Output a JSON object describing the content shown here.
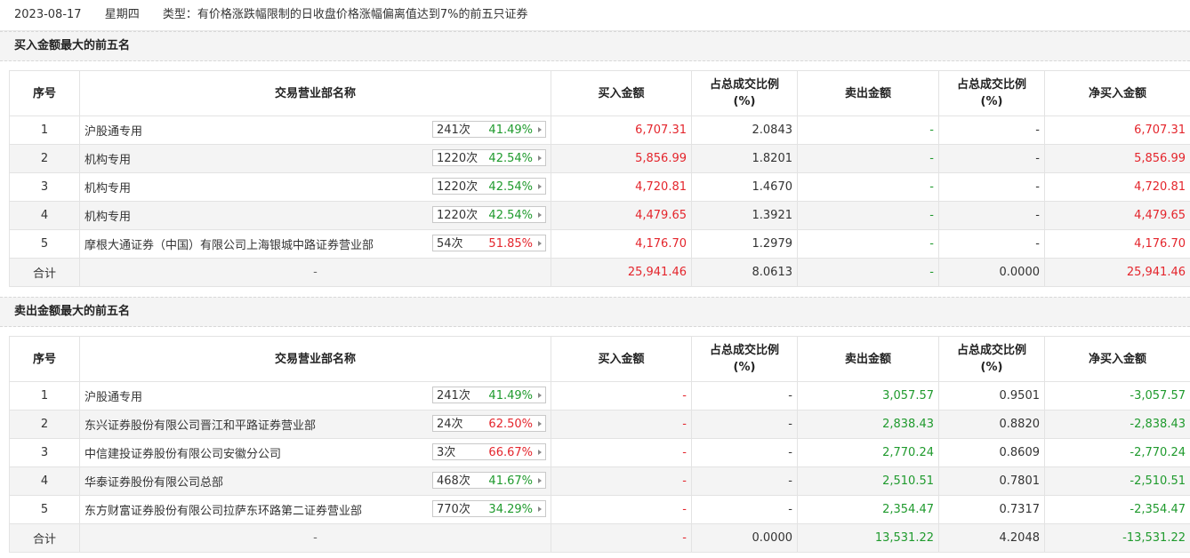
{
  "header": {
    "date": "2023-08-17",
    "weekday": "星期四",
    "type_text": "类型：有价格涨跌幅限制的日收盘价格涨幅偏离值达到7%的前五只证券"
  },
  "columns": {
    "seq": "序号",
    "dept": "交易营业部名称",
    "buy": "买入金额",
    "ratio1_line1": "占总成交比例",
    "ratio1_line2": "(%)",
    "sell": "卖出金额",
    "ratio2_line1": "占总成交比例",
    "ratio2_line2": "(%)",
    "net": "净买入金额"
  },
  "buy_section": {
    "title": "买入金额最大的前五名",
    "rows": [
      {
        "seq": "1",
        "name": "沪股通专用",
        "count": "241次",
        "pct": "41.49%",
        "pct_color": "green",
        "buy": "6,707.31",
        "buy_ratio": "2.0843",
        "sell": "-",
        "sell_ratio": "-",
        "net": "6,707.31"
      },
      {
        "seq": "2",
        "name": "机构专用",
        "count": "1220次",
        "pct": "42.54%",
        "pct_color": "green",
        "buy": "5,856.99",
        "buy_ratio": "1.8201",
        "sell": "-",
        "sell_ratio": "-",
        "net": "5,856.99"
      },
      {
        "seq": "3",
        "name": "机构专用",
        "count": "1220次",
        "pct": "42.54%",
        "pct_color": "green",
        "buy": "4,720.81",
        "buy_ratio": "1.4670",
        "sell": "-",
        "sell_ratio": "-",
        "net": "4,720.81"
      },
      {
        "seq": "4",
        "name": "机构专用",
        "count": "1220次",
        "pct": "42.54%",
        "pct_color": "green",
        "buy": "4,479.65",
        "buy_ratio": "1.3921",
        "sell": "-",
        "sell_ratio": "-",
        "net": "4,479.65"
      },
      {
        "seq": "5",
        "name": "摩根大通证券（中国）有限公司上海银城中路证券营业部",
        "count": "54次",
        "pct": "51.85%",
        "pct_color": "red",
        "buy": "4,176.70",
        "buy_ratio": "1.2979",
        "sell": "-",
        "sell_ratio": "-",
        "net": "4,176.70"
      }
    ],
    "total": {
      "label": "合计",
      "name": "-",
      "buy": "25,941.46",
      "buy_ratio": "8.0613",
      "sell": "-",
      "sell_ratio": "0.0000",
      "net": "25,941.46"
    }
  },
  "sell_section": {
    "title": "卖出金额最大的前五名",
    "rows": [
      {
        "seq": "1",
        "name": "沪股通专用",
        "count": "241次",
        "pct": "41.49%",
        "pct_color": "green",
        "buy": "-",
        "buy_ratio": "-",
        "sell": "3,057.57",
        "sell_ratio": "0.9501",
        "net": "-3,057.57"
      },
      {
        "seq": "2",
        "name": "东兴证券股份有限公司晋江和平路证券营业部",
        "count": "24次",
        "pct": "62.50%",
        "pct_color": "red",
        "buy": "-",
        "buy_ratio": "-",
        "sell": "2,838.43",
        "sell_ratio": "0.8820",
        "net": "-2,838.43"
      },
      {
        "seq": "3",
        "name": "中信建投证券股份有限公司安徽分公司",
        "count": "3次",
        "pct": "66.67%",
        "pct_color": "red",
        "buy": "-",
        "buy_ratio": "-",
        "sell": "2,770.24",
        "sell_ratio": "0.8609",
        "net": "-2,770.24"
      },
      {
        "seq": "4",
        "name": "华泰证券股份有限公司总部",
        "count": "468次",
        "pct": "41.67%",
        "pct_color": "green",
        "buy": "-",
        "buy_ratio": "-",
        "sell": "2,510.51",
        "sell_ratio": "0.7801",
        "net": "-2,510.51"
      },
      {
        "seq": "5",
        "name": "东方财富证券股份有限公司拉萨东环路第二证券营业部",
        "count": "770次",
        "pct": "34.29%",
        "pct_color": "green",
        "buy": "-",
        "buy_ratio": "-",
        "sell": "2,354.47",
        "sell_ratio": "0.7317",
        "net": "-2,354.47"
      }
    ],
    "total": {
      "label": "合计",
      "name": "-",
      "buy": "-",
      "buy_ratio": "0.0000",
      "sell": "13,531.22",
      "sell_ratio": "4.2048",
      "net": "-13,531.22"
    }
  },
  "colors": {
    "red": "#e4252c",
    "green": "#1f9a2d"
  }
}
